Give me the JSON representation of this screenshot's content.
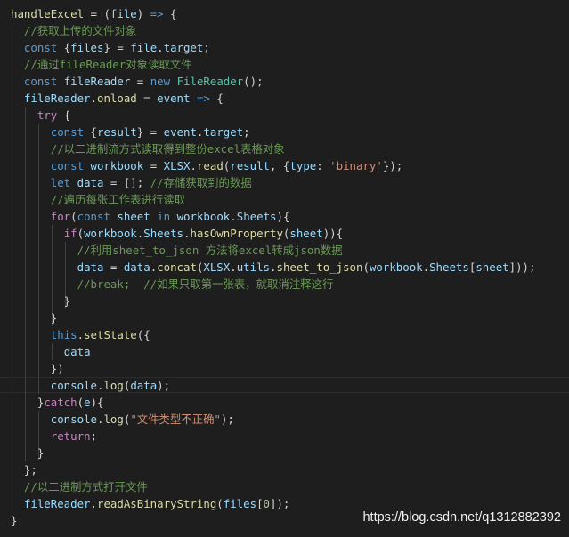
{
  "watermark": "https://blog.csdn.net/q1312882392",
  "colors": {
    "background": "#1e1e1e",
    "keyword": "#569cd6",
    "control": "#c586c0",
    "function": "#dcdcaa",
    "variable": "#9cdcfe",
    "class": "#4ec9b0",
    "string": "#ce9178",
    "number": "#b5cea8",
    "comment": "#6a9955",
    "text": "#d4d4d4"
  },
  "code_lines": [
    [
      [
        "fn",
        "handleExcel"
      ],
      [
        "pl",
        " = ("
      ],
      [
        "var",
        "file"
      ],
      [
        "pl",
        ") "
      ],
      [
        "kw",
        "=>"
      ],
      [
        "pl",
        " {"
      ]
    ],
    [
      [
        "pl",
        "  "
      ],
      [
        "cm",
        "//获取上传的文件对象"
      ]
    ],
    [
      [
        "pl",
        "  "
      ],
      [
        "kw",
        "const"
      ],
      [
        "pl",
        " {"
      ],
      [
        "var",
        "files"
      ],
      [
        "pl",
        "} = "
      ],
      [
        "var",
        "file"
      ],
      [
        "pl",
        "."
      ],
      [
        "var",
        "target"
      ],
      [
        "pl",
        ";"
      ]
    ],
    [
      [
        "pl",
        "  "
      ],
      [
        "cm",
        "//通过fileReader对象读取文件"
      ]
    ],
    [
      [
        "pl",
        "  "
      ],
      [
        "kw",
        "const"
      ],
      [
        "pl",
        " "
      ],
      [
        "var",
        "fileReader"
      ],
      [
        "pl",
        " = "
      ],
      [
        "kw",
        "new"
      ],
      [
        "pl",
        " "
      ],
      [
        "cls",
        "FileReader"
      ],
      [
        "pl",
        "();"
      ]
    ],
    [
      [
        "pl",
        "  "
      ],
      [
        "var",
        "fileReader"
      ],
      [
        "pl",
        "."
      ],
      [
        "fn",
        "onload"
      ],
      [
        "pl",
        " = "
      ],
      [
        "var",
        "event"
      ],
      [
        "pl",
        " "
      ],
      [
        "kw",
        "=>"
      ],
      [
        "pl",
        " {"
      ]
    ],
    [
      [
        "pl",
        "    "
      ],
      [
        "ctl",
        "try"
      ],
      [
        "pl",
        " {"
      ]
    ],
    [
      [
        "pl",
        "      "
      ],
      [
        "kw",
        "const"
      ],
      [
        "pl",
        " {"
      ],
      [
        "var",
        "result"
      ],
      [
        "pl",
        "} = "
      ],
      [
        "var",
        "event"
      ],
      [
        "pl",
        "."
      ],
      [
        "var",
        "target"
      ],
      [
        "pl",
        ";"
      ]
    ],
    [
      [
        "pl",
        "      "
      ],
      [
        "cm",
        "//以二进制流方式读取得到整份excel表格对象"
      ]
    ],
    [
      [
        "pl",
        "      "
      ],
      [
        "kw",
        "const"
      ],
      [
        "pl",
        " "
      ],
      [
        "var",
        "workbook"
      ],
      [
        "pl",
        " = "
      ],
      [
        "var",
        "XLSX"
      ],
      [
        "pl",
        "."
      ],
      [
        "fn",
        "read"
      ],
      [
        "pl",
        "("
      ],
      [
        "var",
        "result"
      ],
      [
        "pl",
        ", {"
      ],
      [
        "var",
        "type"
      ],
      [
        "pl",
        ": "
      ],
      [
        "str",
        "'binary'"
      ],
      [
        "pl",
        "});"
      ]
    ],
    [
      [
        "pl",
        "      "
      ],
      [
        "kw",
        "let"
      ],
      [
        "pl",
        " "
      ],
      [
        "var",
        "data"
      ],
      [
        "pl",
        " = []; "
      ],
      [
        "cm",
        "//存储获取到的数据"
      ]
    ],
    [
      [
        "pl",
        "      "
      ],
      [
        "cm",
        "//遍历每张工作表进行读取"
      ]
    ],
    [
      [
        "pl",
        "      "
      ],
      [
        "ctl",
        "for"
      ],
      [
        "pl",
        "("
      ],
      [
        "kw",
        "const"
      ],
      [
        "pl",
        " "
      ],
      [
        "var",
        "sheet"
      ],
      [
        "pl",
        " "
      ],
      [
        "kw",
        "in"
      ],
      [
        "pl",
        " "
      ],
      [
        "var",
        "workbook"
      ],
      [
        "pl",
        "."
      ],
      [
        "var",
        "Sheets"
      ],
      [
        "pl",
        "){"
      ]
    ],
    [
      [
        "pl",
        "        "
      ],
      [
        "ctl",
        "if"
      ],
      [
        "pl",
        "("
      ],
      [
        "var",
        "workbook"
      ],
      [
        "pl",
        "."
      ],
      [
        "var",
        "Sheets"
      ],
      [
        "pl",
        "."
      ],
      [
        "fn",
        "hasOwnProperty"
      ],
      [
        "pl",
        "("
      ],
      [
        "var",
        "sheet"
      ],
      [
        "pl",
        ")){"
      ]
    ],
    [
      [
        "pl",
        "          "
      ],
      [
        "cm",
        "//利用sheet_to_json 方法将excel转成json数据"
      ]
    ],
    [
      [
        "pl",
        "          "
      ],
      [
        "var",
        "data"
      ],
      [
        "pl",
        " = "
      ],
      [
        "var",
        "data"
      ],
      [
        "pl",
        "."
      ],
      [
        "fn",
        "concat"
      ],
      [
        "pl",
        "("
      ],
      [
        "var",
        "XLSX"
      ],
      [
        "pl",
        "."
      ],
      [
        "var",
        "utils"
      ],
      [
        "pl",
        "."
      ],
      [
        "fn",
        "sheet_to_json"
      ],
      [
        "pl",
        "("
      ],
      [
        "var",
        "workbook"
      ],
      [
        "pl",
        "."
      ],
      [
        "var",
        "Sheets"
      ],
      [
        "pl",
        "["
      ],
      [
        "var",
        "sheet"
      ],
      [
        "pl",
        "]));"
      ]
    ],
    [
      [
        "pl",
        "          "
      ],
      [
        "cm",
        "//break;  //如果只取第一张表，就取消注释这行"
      ]
    ],
    [
      [
        "pl",
        "        }"
      ]
    ],
    [
      [
        "pl",
        "      }"
      ]
    ],
    [
      [
        "pl",
        "      "
      ],
      [
        "kw",
        "this"
      ],
      [
        "pl",
        "."
      ],
      [
        "fn",
        "setState"
      ],
      [
        "pl",
        "({"
      ]
    ],
    [
      [
        "pl",
        "        "
      ],
      [
        "var",
        "data"
      ]
    ],
    [
      [
        "pl",
        "      })"
      ]
    ],
    [
      [
        "pl",
        "      "
      ],
      [
        "var",
        "console"
      ],
      [
        "pl",
        "."
      ],
      [
        "fn",
        "log"
      ],
      [
        "pl",
        "("
      ],
      [
        "var",
        "data"
      ],
      [
        "pl",
        ");"
      ]
    ],
    [
      [
        "pl",
        "    }"
      ],
      [
        "ctl",
        "catch"
      ],
      [
        "pl",
        "("
      ],
      [
        "var",
        "e"
      ],
      [
        "pl",
        "){"
      ]
    ],
    [
      [
        "pl",
        "      "
      ],
      [
        "var",
        "console"
      ],
      [
        "pl",
        "."
      ],
      [
        "fn",
        "log"
      ],
      [
        "pl",
        "("
      ],
      [
        "str",
        "\"文件类型不正确\""
      ],
      [
        "pl",
        ");"
      ]
    ],
    [
      [
        "pl",
        "      "
      ],
      [
        "ctl",
        "return"
      ],
      [
        "pl",
        ";"
      ]
    ],
    [
      [
        "pl",
        "    }"
      ]
    ],
    [
      [
        "pl",
        "  };"
      ]
    ],
    [
      [
        "pl",
        "  "
      ],
      [
        "cm",
        "//以二进制方式打开文件"
      ]
    ],
    [
      [
        "pl",
        "  "
      ],
      [
        "var",
        "fileReader"
      ],
      [
        "pl",
        "."
      ],
      [
        "fn",
        "readAsBinaryString"
      ],
      [
        "pl",
        "("
      ],
      [
        "var",
        "files"
      ],
      [
        "pl",
        "["
      ],
      [
        "num",
        "0"
      ],
      [
        "pl",
        "]);"
      ]
    ],
    [
      [
        "pl",
        "}"
      ]
    ]
  ]
}
